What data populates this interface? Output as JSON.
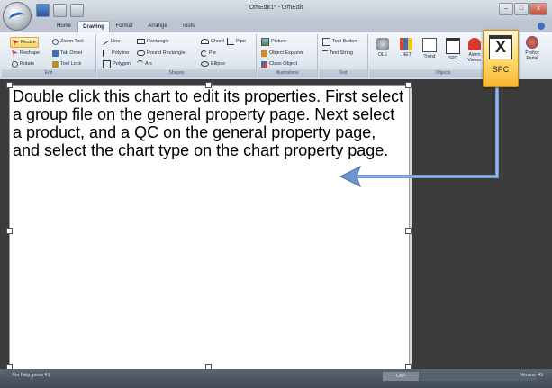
{
  "window": {
    "title": "OmEdit1* - OmEdit"
  },
  "window_controls": {
    "minimize": "–",
    "maximize": "□",
    "close": "x"
  },
  "tabs": [
    {
      "label": "Home",
      "active": false
    },
    {
      "label": "Drawing",
      "active": true
    },
    {
      "label": "Format",
      "active": false
    },
    {
      "label": "Arrange",
      "active": false
    },
    {
      "label": "Tools",
      "active": false
    }
  ],
  "ribbon": {
    "edit": {
      "label": "Edit",
      "items": [
        "Resize",
        "Zoom Tool",
        "Reshape",
        "Tab Order",
        "Rotate",
        "Tool Lock"
      ]
    },
    "shapes": {
      "label": "Shapes",
      "items": [
        "Line",
        "Rectangle",
        "Chord",
        "Pipe",
        "Polyline",
        "Round Rectangle",
        "Pie",
        "Polygon",
        "Arc",
        "Ellipse"
      ]
    },
    "illustrations": {
      "label": "Illustrations",
      "items": [
        "Picture",
        "Object Explorer",
        "Class Object"
      ]
    },
    "text": {
      "label": "Text",
      "items": [
        "Text Button",
        "Text String"
      ]
    },
    "objects": {
      "label": "Objects",
      "buttons": [
        "OLE",
        ".NET",
        "Trend",
        "SPC",
        "Alarm Viewer"
      ]
    },
    "extra": {
      "button": "Proficy Portal"
    }
  },
  "spc_popout": {
    "label": "SPC",
    "glyph": "X"
  },
  "chart": {
    "instructions": "Double click this chart to edit its properties. First select a group file on the general property page.  Next select a product, and a QC on the general property page, and select the chart type on the chart property page."
  },
  "status": {
    "help_text": "For Help, press F1",
    "indicator": "CAP",
    "version": "Version: 45"
  },
  "colors": {
    "accent_arrow": "#6f95cf",
    "highlight": "#ffd25c",
    "canvas_bg": "#3b3b3b"
  }
}
